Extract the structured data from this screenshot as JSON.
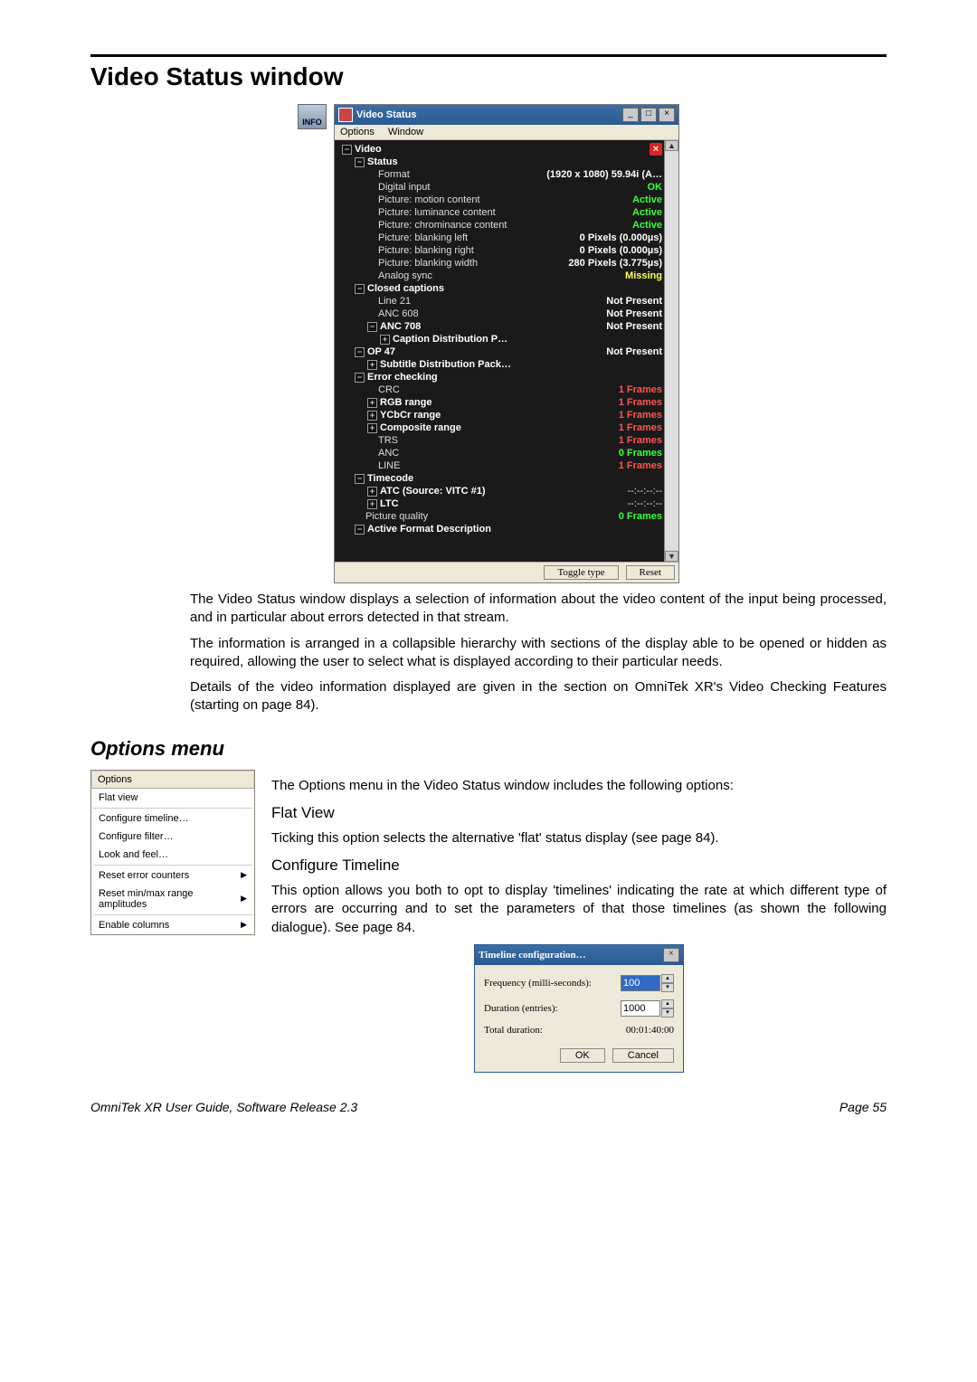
{
  "page": {
    "title": "Video Status window",
    "footer_left": "OmniTek XR User Guide, Software Release 2.3",
    "footer_right": "Page 55",
    "info_icon_label": "INFO"
  },
  "vs_window": {
    "title": "Video Status",
    "menu": {
      "options": "Options",
      "window": "Window"
    },
    "buttons": {
      "toggle": "Toggle type",
      "reset": "Reset"
    },
    "tree": {
      "video": "Video",
      "status": "Status",
      "format_l": "Format",
      "format_v": "(1920 x 1080) 59.94i (A…",
      "di_l": "Digital input",
      "di_v": "OK",
      "pmc_l": "Picture: motion content",
      "pmc_v": "Active",
      "plc_l": "Picture: luminance content",
      "plc_v": "Active",
      "pcc_l": "Picture: chrominance content",
      "pcc_v": "Active",
      "pbl_l": "Picture: blanking left",
      "pbl_v": "0 Pixels (0.000µs)",
      "pbr_l": "Picture: blanking right",
      "pbr_v": "0 Pixels (0.000µs)",
      "pbw_l": "Picture: blanking width",
      "pbw_v": "280 Pixels (3.775µs)",
      "as_l": "Analog sync",
      "as_v": "Missing",
      "cc": "Closed captions",
      "l21_l": "Line 21",
      "l21_v": "Not Present",
      "a608_l": "ANC 608",
      "a608_v": "Not Present",
      "a708_l": "ANC 708",
      "a708_v": "Not Present",
      "cdp": "Caption Distribution P…",
      "op47_l": "OP 47",
      "op47_v": "Not Present",
      "sdp": "Subtitle Distribution Pack…",
      "ec": "Error checking",
      "crc_l": "CRC",
      "crc_v": "1 Frames",
      "rgb_l": "RGB range",
      "rgb_v": "1 Frames",
      "ycc_l": "YCbCr range",
      "ycc_v": "1 Frames",
      "comp_l": "Composite range",
      "comp_v": "1 Frames",
      "trs_l": "TRS",
      "trs_v": "1 Frames",
      "anc_l": "ANC",
      "anc_v": "0 Frames",
      "line_l": "LINE",
      "line_v": "1 Frames",
      "tc": "Timecode",
      "atc_l": "ATC (Source: VITC #1)",
      "atc_v": "--:--:--:--",
      "ltc_l": "LTC",
      "ltc_v": "--:--:--:--",
      "pq_l": "Picture quality",
      "pq_v": "0 Frames",
      "afd": "Active Format Description"
    }
  },
  "paragraphs": {
    "p1": "The Video Status window displays a selection of information about the video content of the input being processed, and in particular about errors detected in that stream.",
    "p2": "The information is arranged in a collapsible hierarchy with sections of the display able to be opened or hidden as required, allowing the user to select what is displayed according to their particular needs.",
    "p3": "Details of the video information displayed are given in the section on OmniTek XR's Video Checking Features (starting on page 84).",
    "options_title": "Options menu",
    "opt_intro": "The Options menu in the Video Status window includes the following options:",
    "fv_h": "Flat View",
    "fv_p": "Ticking this option selects the alternative 'flat' status display (see page 84).",
    "ct_h": "Configure Timeline",
    "ct_p": "This option allows you both to opt to display 'timelines' indicating the rate at which different type of errors are occurring and to set the parameters of that those timelines (as shown the following dialogue). See page 84."
  },
  "options_menu": {
    "header": "Options",
    "items": {
      "i0": "Flat view",
      "i1": "Configure timeline…",
      "i2": "Configure filter…",
      "i3": "Look and feel…",
      "i4": "Reset error counters",
      "i5": "Reset min/max range amplitudes",
      "i6": "Enable columns"
    }
  },
  "dialog": {
    "title": "Timeline configuration…",
    "freq_l": "Frequency (milli-seconds):",
    "freq_v": "100",
    "dur_l": "Duration (entries):",
    "dur_v": "1000",
    "tot_l": "Total duration:",
    "tot_v": "00:01:40:00",
    "ok": "OK",
    "cancel": "Cancel"
  }
}
